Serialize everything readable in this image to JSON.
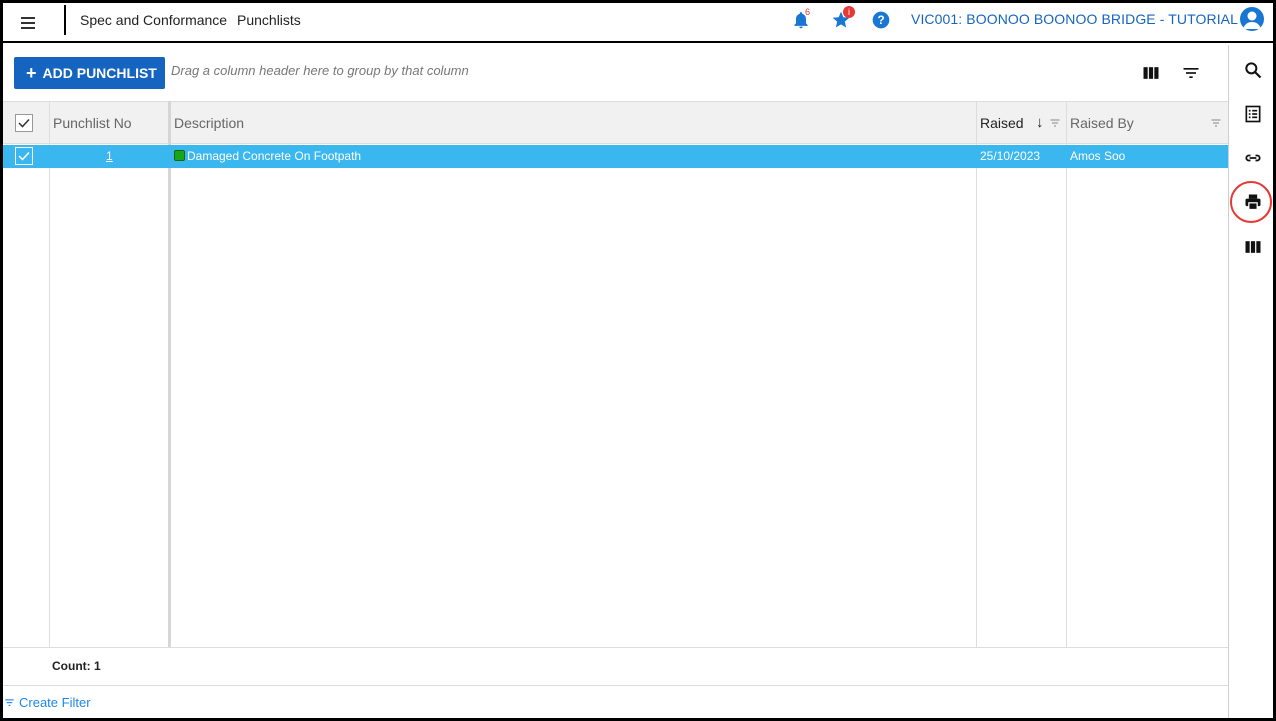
{
  "header": {
    "breadcrumb_module": "Spec and Conformance",
    "breadcrumb_page": "Punchlists",
    "notifications_count": "6",
    "favourites_badge": "i",
    "project_name": "VIC001: BOONOO BOONOO BRIDGE - TUTORIAL"
  },
  "toolbar": {
    "add_label": "ADD PUNCHLIST",
    "group_hint": "Drag a column header here to group by that column"
  },
  "grid": {
    "columns": [
      "Punchlist No",
      "Description",
      "Raised",
      "Raised By"
    ],
    "rows": [
      {
        "selected": true,
        "no": "1",
        "description": "Damaged Concrete On Footpath",
        "raised": "25/10/2023",
        "raised_by": "Amos Soo",
        "status_color": "#1aa51a"
      }
    ],
    "sort": {
      "column": "Raised",
      "direction": "descending"
    }
  },
  "footer": {
    "count_label": "Count: 1",
    "create_filter_label": "Create Filter"
  },
  "sidebar_icons": [
    "search-icon",
    "list-icon",
    "link-icon",
    "print-icon",
    "columns-icon"
  ],
  "colors": {
    "accent": "#1565c0",
    "selected_row": "#3bb7f0",
    "highlight_ring": "#e53935"
  }
}
